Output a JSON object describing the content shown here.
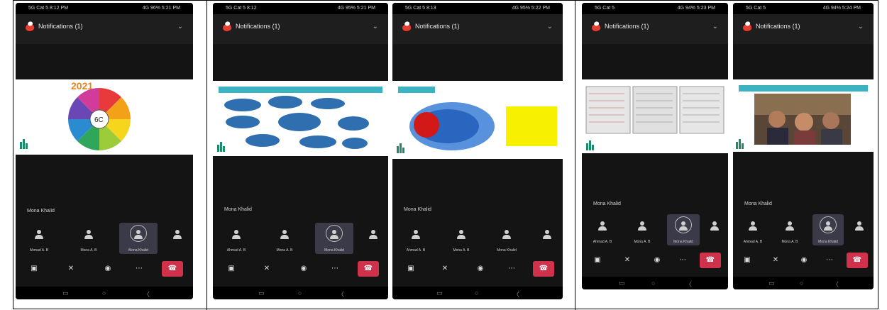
{
  "screens": [
    {
      "status_time": "5G Cat 5 8:12 PM",
      "status_right": "4G 96% 5:21 PM",
      "meeting_title": "Notifications (1)",
      "slide_kind": "wheel",
      "slide_year": "2021",
      "slide_center": "6C",
      "speaker_label": "Mona Khalid",
      "tiles": [
        "Ahmad A. B",
        "Mona A. B",
        "Mona Khalid",
        ""
      ]
    },
    {
      "status_time": "5G Cat 5 8:12",
      "status_right": "4G 95% 5:21 PM",
      "meeting_title": "Notifications (1)",
      "slide_kind": "clouds",
      "slide_band": "",
      "speaker_label": "Mona Khalid",
      "tiles": [
        "Ahmad A. B",
        "Mona A. B",
        "Mona Khalid",
        ""
      ]
    },
    {
      "status_time": "5G Cat 5 8:13",
      "status_right": "4G 95% 5:22 PM",
      "meeting_title": "Notifications (1)",
      "slide_kind": "venn",
      "slide_band": "",
      "speaker_label": "Mona Khalid",
      "tiles": [
        "Ahmad A. B",
        "Mona A. B",
        "Mona Khalid",
        ""
      ]
    },
    {
      "status_time": "5G Cat 5",
      "status_right": "4G 94% 5:23 PM",
      "meeting_title": "Notifications (1)",
      "slide_kind": "docs",
      "slide_band": "",
      "speaker_label": "Mona Khalid",
      "tiles": [
        "Ahmad A. B",
        "Mona A. B",
        "Mona Khalid",
        ""
      ]
    },
    {
      "status_time": "5G Cat 5",
      "status_right": "4G 94% 5:24 PM",
      "meeting_title": "Notifications (1)",
      "slide_kind": "video",
      "slide_band": "",
      "speaker_label": "Mona Khalid",
      "tiles": [
        "Ahmad A. B",
        "Mona A. B",
        "Mona Khalid",
        ""
      ]
    }
  ],
  "colors": {
    "end_call": "#d0324b",
    "band": "#3bb3c3",
    "cloud": "#2f6fb0",
    "venn_red": "#d31818",
    "venn_blue": "#3c7fd6",
    "note_yellow": "#f7f000"
  },
  "icons": {
    "camera": "camera-icon",
    "mic": "mic-off-icon",
    "audio": "headset-icon",
    "more": "more-icon",
    "end": "end-call-icon"
  }
}
